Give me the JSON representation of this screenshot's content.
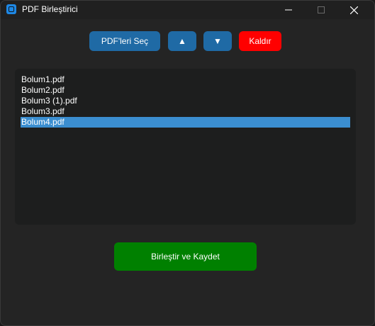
{
  "window": {
    "title": "PDF Birleştirici"
  },
  "toolbar": {
    "select_label": "PDF'leri Seç",
    "up_label": "▲",
    "down_label": "▼",
    "remove_label": "Kaldır"
  },
  "file_list": {
    "items": [
      "Bolum1.pdf",
      "Bolum2.pdf",
      "Bolum3 (1).pdf",
      "Bolum3.pdf",
      "Bolum4.pdf"
    ],
    "selected_index": 4
  },
  "merge": {
    "label": "Birleştir ve Kaydet"
  },
  "colors": {
    "accent": "#1f6aa5",
    "danger": "#ff0000",
    "success": "#008000",
    "selection": "#3b8ed0"
  }
}
